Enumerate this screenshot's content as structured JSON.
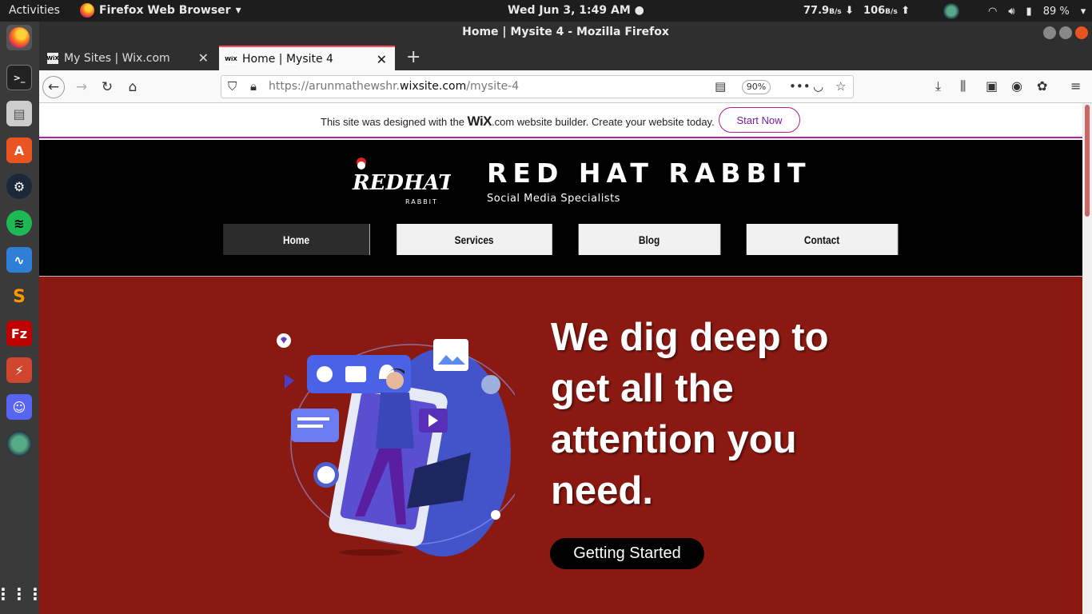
{
  "os": {
    "activities": "Activities",
    "app_name": "Firefox Web Browser",
    "clock": "Wed Jun  3,  1:49 AM",
    "net_down": "77.9",
    "net_down_unit": "B/s",
    "net_up": "106",
    "net_up_unit": "B/s",
    "battery": "89 %"
  },
  "browser": {
    "window_title": "Home | Mysite 4 - Mozilla Firefox",
    "tabs": [
      {
        "label": "My Sites | Wix.com",
        "favicon": "WiX"
      },
      {
        "label": "Home | Mysite 4",
        "favicon": "WiX"
      }
    ],
    "url_prefix": "https://arunmathewshr.",
    "url_domain": "wixsite.com",
    "url_path": "/mysite-4",
    "zoom": "90%"
  },
  "wix_banner": {
    "text_before": "This site was designed with the ",
    "brand": "WiX",
    "text_after": ".com website builder. Create your website today.",
    "button": "Start Now"
  },
  "site": {
    "logo_text": "REDHAT",
    "logo_sub": "RABBIT",
    "title": "RED HAT RABBIT",
    "tagline": "Social Media Specialists",
    "menu": [
      "Home",
      "Services",
      "Blog",
      "Contact"
    ],
    "headline": "We dig deep to get all the attention you need.",
    "cta": "Getting Started"
  },
  "colors": {
    "hero_bg": "#8a1912",
    "accent": "#b21ea8",
    "header_bg": "#000000"
  }
}
